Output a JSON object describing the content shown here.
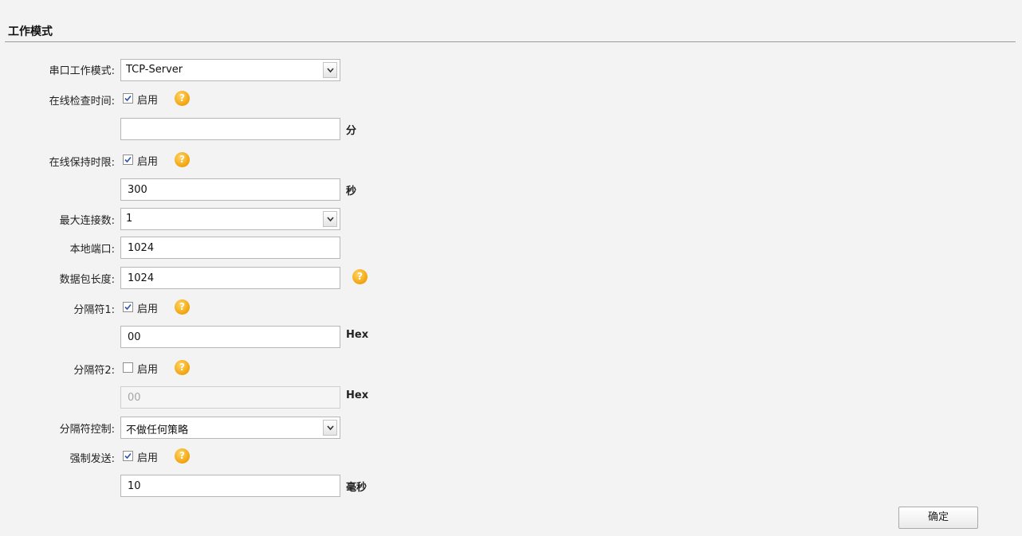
{
  "section": {
    "title": "工作模式"
  },
  "form": {
    "serial_mode": {
      "label": "串口工作模式:",
      "selected": "TCP-Server"
    },
    "online_check": {
      "label": "在线检查时间:",
      "enable_label": "启用",
      "checked": true,
      "value": "",
      "unit": "分"
    },
    "keepalive": {
      "label": "在线保持时限:",
      "enable_label": "启用",
      "checked": true,
      "value": "300",
      "unit": "秒"
    },
    "max_connections": {
      "label": "最大连接数:",
      "selected": "1"
    },
    "local_port": {
      "label": "本地端口:",
      "value": "1024"
    },
    "packet_length": {
      "label": "数据包长度:",
      "value": "1024"
    },
    "delimiter1": {
      "label": "分隔符1:",
      "enable_label": "启用",
      "checked": true,
      "value": "00",
      "unit": "Hex"
    },
    "delimiter2": {
      "label": "分隔符2:",
      "enable_label": "启用",
      "checked": false,
      "value": "00",
      "unit": "Hex"
    },
    "delimiter_control": {
      "label": "分隔符控制:",
      "selected": "不做任何策略"
    },
    "force_send": {
      "label": "强制发送:",
      "enable_label": "启用",
      "checked": true,
      "value": "10",
      "unit": "毫秒"
    },
    "help_glyph": "?",
    "confirm_label": "确定"
  },
  "icons": {
    "help": "help-icon",
    "dropdown": "chevron-down-icon",
    "check": "checkmark-icon"
  },
  "colors": {
    "background": "#f3f3f3",
    "help_icon": "#f2a20c",
    "divider": "#9a9a9a"
  }
}
